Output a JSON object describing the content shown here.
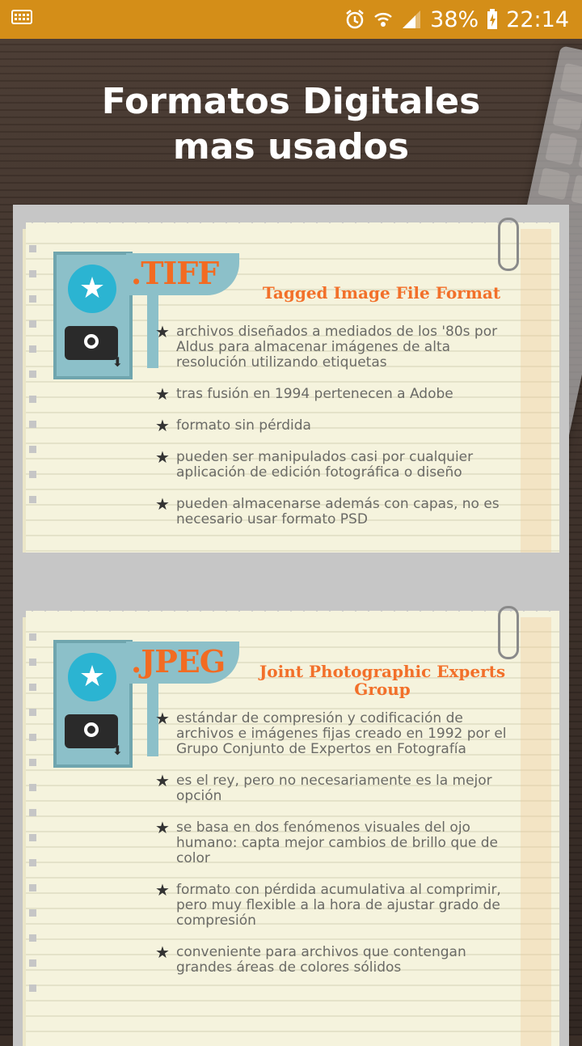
{
  "status_bar": {
    "battery": "38%",
    "time": "22:14",
    "icons": [
      "keyboard-icon",
      "alarm-icon",
      "wifi-icon",
      "signal-icon",
      "battery-charging-icon"
    ]
  },
  "header": {
    "title_line1": "Formatos Digitales",
    "title_line2": "mas usados"
  },
  "cards": [
    {
      "format": ".TIFF",
      "full_name_line1": "Tagged Image File Format",
      "full_name_line2": "",
      "bullets": [
        "archivos diseñados a mediados de los '80s por Aldus para almacenar imágenes de alta resolución utilizando etiquetas",
        "tras fusión en 1994 pertenecen a Adobe",
        "formato sin pérdida",
        "pueden ser manipulados casi por cualquier aplicación de edición fotográfica o diseño",
        "pueden almacenarse además con capas, no es necesario usar formato PSD"
      ]
    },
    {
      "format": ".JPEG",
      "full_name_line1": "Joint Photographic Experts",
      "full_name_line2": "Group",
      "bullets": [
        "estándar de compresión y codificación de archivos e imágenes fijas creado en 1992 por el Grupo Conjunto de Expertos  en Fotografía",
        "es el rey, pero no necesariamente es la mejor opción",
        "se basa en dos fenómenos visuales del ojo humano: capta mejor cambios de brillo que de color",
        "formato con pérdida acumulativa al comprimir, pero muy flexible a la hora de ajustar grado de compresión",
        "conveniente para archivos que contengan grandes áreas de colores sólidos"
      ]
    }
  ]
}
